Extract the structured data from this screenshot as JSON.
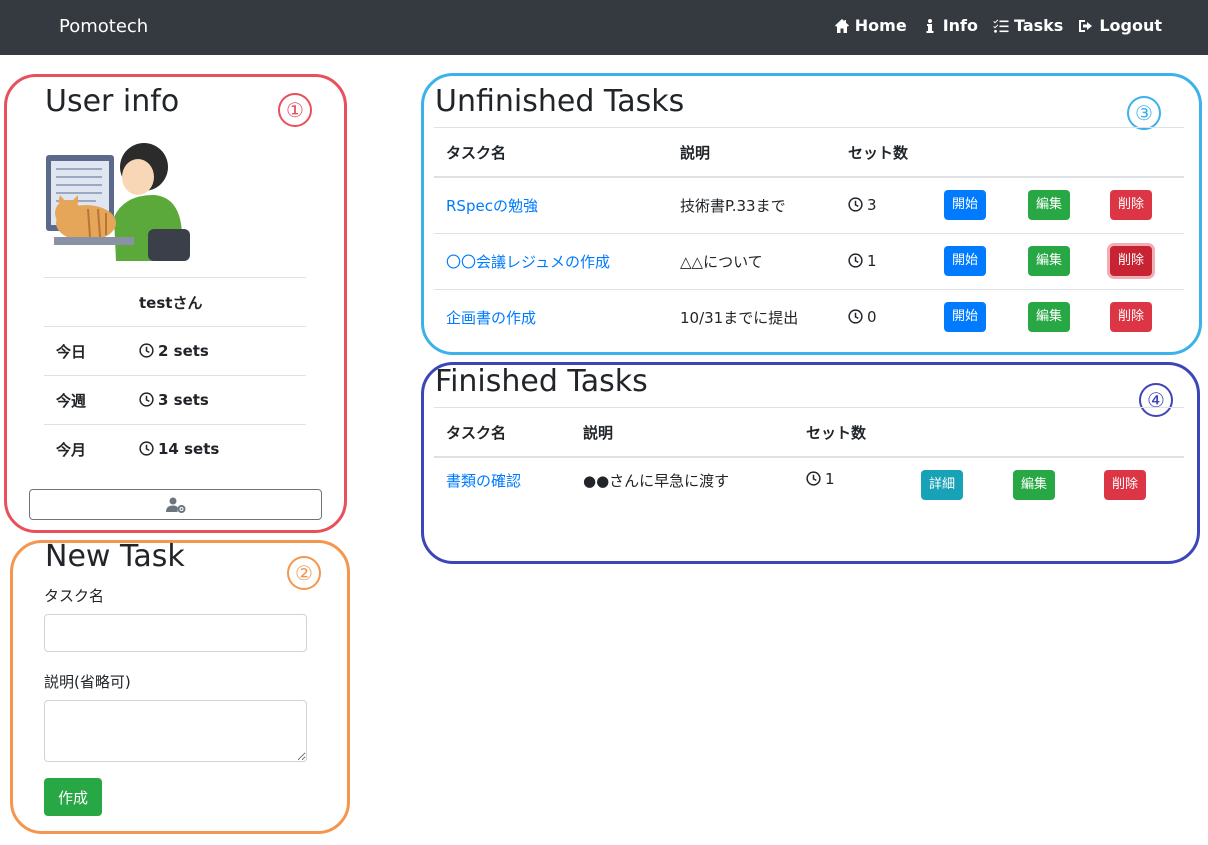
{
  "navbar": {
    "brand": "Pomotech",
    "links": [
      {
        "label": "Home",
        "icon": "home-icon"
      },
      {
        "label": "Info",
        "icon": "info-icon"
      },
      {
        "label": "Tasks",
        "icon": "tasks-icon"
      },
      {
        "label": "Logout",
        "icon": "logout-icon"
      }
    ]
  },
  "markers": [
    "①",
    "②",
    "③",
    "④"
  ],
  "user_info": {
    "title": "User info",
    "username": "testさん",
    "stats": [
      {
        "label": "今日",
        "value": "2 sets"
      },
      {
        "label": "今週",
        "value": "3 sets"
      },
      {
        "label": "今月",
        "value": "14 sets"
      }
    ],
    "settings_icon": "user-cog-icon"
  },
  "new_task": {
    "title": "New Task",
    "name_label": "タスク名",
    "name_value": "",
    "desc_label": "説明(省略可)",
    "desc_value": "",
    "submit_label": "作成"
  },
  "unfinished": {
    "title": "Unfinished Tasks",
    "headers": [
      "タスク名",
      "説明",
      "セット数"
    ],
    "rows": [
      {
        "name": "RSpecの勉強",
        "desc": "技術書P.33まで",
        "sets": "3",
        "start": "開始",
        "edit": "編集",
        "delete": "削除"
      },
      {
        "name": "〇〇会議レジュメの作成",
        "desc": "△△について",
        "sets": "1",
        "start": "開始",
        "edit": "編集",
        "delete": "削除"
      },
      {
        "name": "企画書の作成",
        "desc": "10/31までに提出",
        "sets": "0",
        "start": "開始",
        "edit": "編集",
        "delete": "削除"
      }
    ]
  },
  "finished": {
    "title": "Finished Tasks",
    "headers": [
      "タスク名",
      "説明",
      "セット数"
    ],
    "rows": [
      {
        "name": "書類の確認",
        "desc": "●●さんに早急に渡す",
        "sets": "1",
        "detail": "詳細",
        "edit": "編集",
        "delete": "削除"
      }
    ]
  },
  "colors": {
    "navbar": "#343a40",
    "primary": "#007bff",
    "success": "#28a745",
    "danger": "#dc3545",
    "info": "#17a2b8",
    "frame_1": "#e8505b",
    "frame_2": "#f4964e",
    "frame_3": "#3bb2ea",
    "frame_4": "#3d45b8"
  }
}
